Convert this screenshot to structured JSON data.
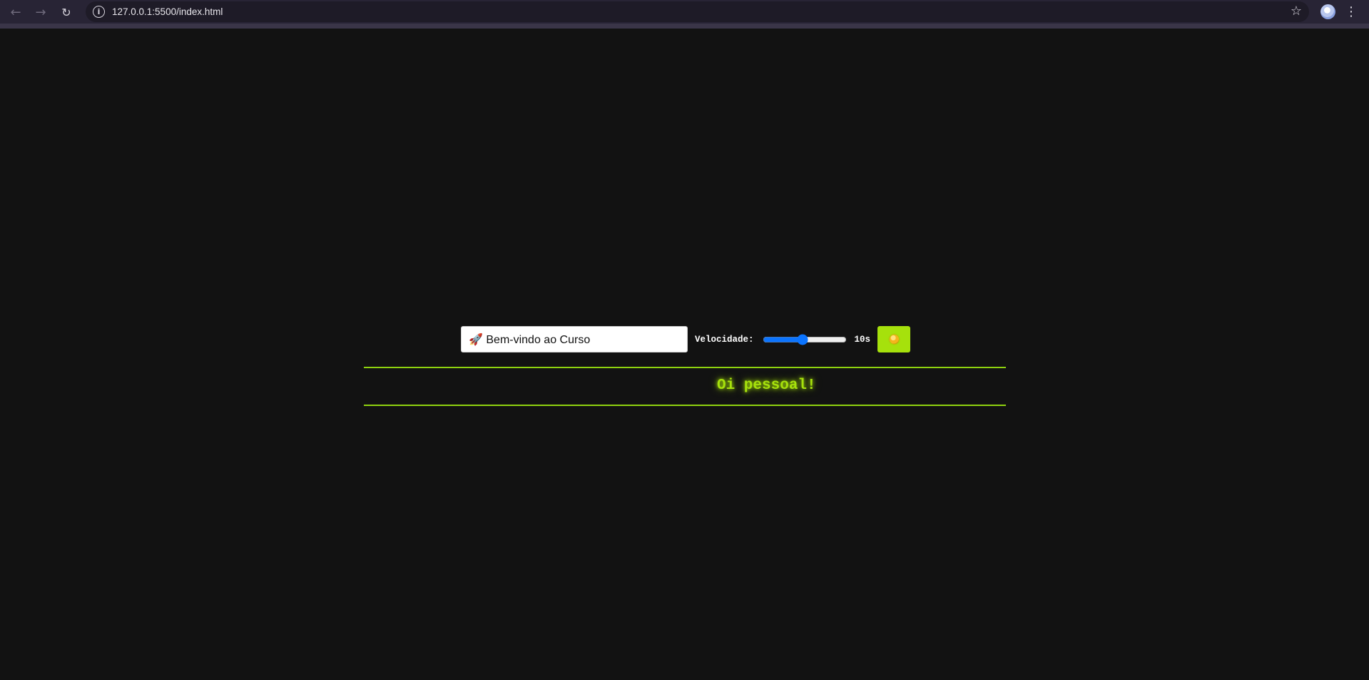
{
  "browser": {
    "back_icon": "←",
    "forward_icon": "→",
    "reload_icon": "↻",
    "site_info_icon": "i",
    "url": "127.0.0.1:5500/index.html",
    "star_icon": "☆",
    "menu_icon": "⋮"
  },
  "controls": {
    "message_value": "🚀 Bem-vindo ao Curso",
    "speed_label": "Velocidade:",
    "speed_value": "10",
    "speed_display": "10s",
    "toggle_icon": "sun-icon"
  },
  "marquee": {
    "text": "Oi pessoal!"
  },
  "colors": {
    "accent": "#a6e10c",
    "background": "#121212",
    "slider": "#0b74ff"
  }
}
